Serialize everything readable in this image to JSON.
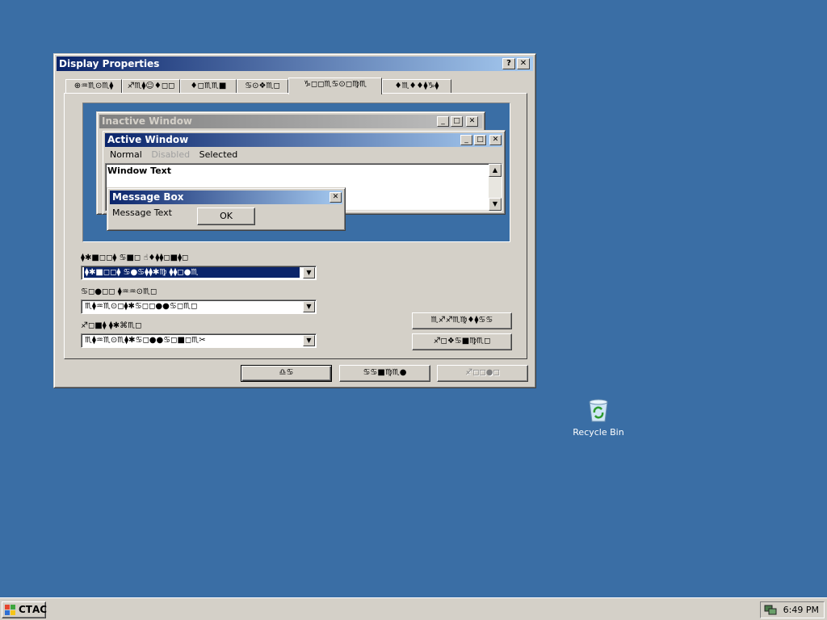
{
  "dialog": {
    "title": "Display Properties",
    "tabs": [
      "⊕♒♏⊙♏⧫",
      "♐♏⧫☺♦◻◻",
      "♦◻♏♏■",
      "♋⊙❖♏◻",
      "♑◻◻♏♋⊙◻♍♏",
      "♦♏♦♦⧫♑⧫"
    ],
    "active_tab_index": 4,
    "preview": {
      "inactive_title": "Inactive Window",
      "active_title": "Active Window",
      "menu_normal": "Normal",
      "menu_disabled": "Disabled",
      "menu_selected": "Selected",
      "window_text": "Window Text",
      "msgbox_title": "Message Box",
      "msgbox_text": "Message Text",
      "msgbox_ok": "OK"
    },
    "scheme_label": "⧫✱■◻◻⧫  ♋■◻  ☝♦⧫⧫◻■⧫◻",
    "scheme_value": "⧫✱■◻◻⧫  ♋●♋⧫⧫✱♍  ⧫⧫◻●♏",
    "item_label": "♋◻●◻◻  ⧫♒♒⊙♏◻",
    "item_value": "♏⧫♒♏⊙◻⧫✱♋◻◻●●♋◻♏◻",
    "font_label": "♐◻■⧫  ⧫✱⌘♏◻",
    "font_value": "♏⧫♒♏⊙♏⧫✱♋◻●●♋◻■◻♏✂",
    "save_as_button": "♏♐♐♏♍♦⧫♋♋",
    "delete_button": "♐◻❖♋■♍♏◻",
    "ok_button": "♎♋",
    "cancel_button": "♋♋■♍♏●",
    "apply_button": "♐◻◻●◻"
  },
  "desktop": {
    "recycle_bin_label": "Recycle Bin"
  },
  "taskbar": {
    "start_label": "СТАС",
    "clock": "6:49 PM"
  },
  "colors": {
    "desktop": "#3a6ea5",
    "active_caption_start": "#0a246a",
    "active_caption_end": "#a6caf0",
    "inactive_caption_start": "#808080",
    "inactive_caption_end": "#c0c0c0",
    "face": "#d4d0c8"
  }
}
